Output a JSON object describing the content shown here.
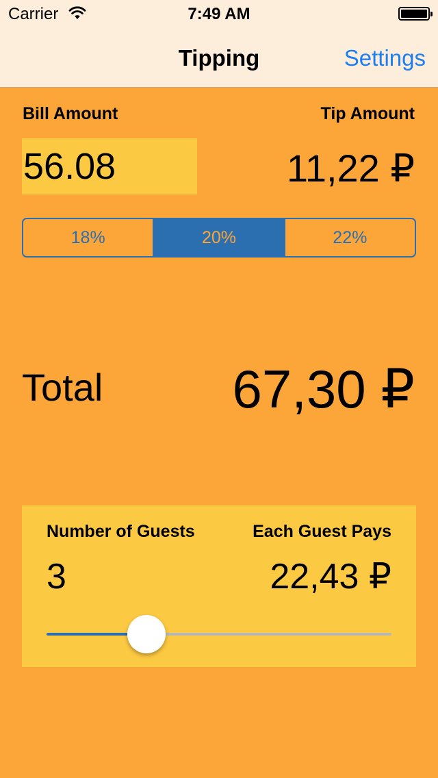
{
  "status_bar": {
    "carrier": "Carrier",
    "time": "7:49 AM"
  },
  "nav": {
    "title": "Tipping",
    "settings_label": "Settings"
  },
  "bill": {
    "label": "Bill Amount",
    "value": "56.08"
  },
  "tip": {
    "label": "Tip Amount",
    "value": "11,22 ₽"
  },
  "tip_options": {
    "selected": 1,
    "items": [
      {
        "label": "18%"
      },
      {
        "label": "20%"
      },
      {
        "label": "22%"
      }
    ]
  },
  "total": {
    "label": "Total",
    "value": "67,30 ₽"
  },
  "guests": {
    "count_label": "Number of Guests",
    "count_value": "3",
    "each_label": "Each Guest Pays",
    "each_value": "22,43 ₽",
    "slider_fraction": 0.29
  },
  "colors": {
    "background": "#fca63a",
    "bar": "#fdeedb",
    "accent_blue": "#2b6fb0",
    "link_blue": "#1c7ef0",
    "highlight_yellow": "#fcc942"
  },
  "icons": {
    "signal": "wifi-icon",
    "battery": "battery-icon"
  }
}
